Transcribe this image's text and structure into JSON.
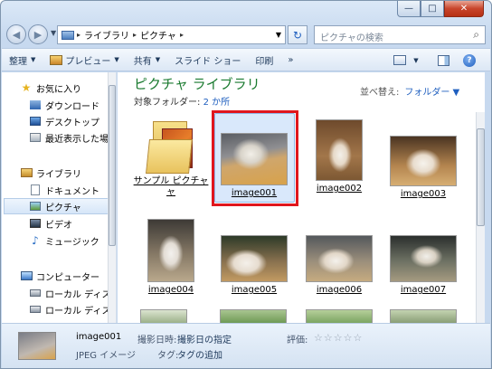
{
  "window": {
    "minimize": "—",
    "maximize": "□",
    "close": "✕"
  },
  "nav": {
    "back_icon": "back-arrow-icon",
    "forward_icon": "forward-arrow-icon"
  },
  "address": {
    "crumbs": [
      "ライブラリ",
      "ピクチャ"
    ],
    "sep": "▸"
  },
  "search": {
    "placeholder": "ピクチャの検索"
  },
  "toolbar": {
    "organize": "整理",
    "preview": "プレビュー",
    "share": "共有",
    "slideshow": "スライド ショー",
    "print": "印刷",
    "more": "»",
    "drop": "▼"
  },
  "sidebar": {
    "favorites": "お気に入り",
    "downloads": "ダウンロード",
    "desktop": "デスクトップ",
    "recent": "最近表示した場所",
    "libraries": "ライブラリ",
    "documents": "ドキュメント",
    "pictures": "ピクチャ",
    "videos": "ビデオ",
    "music": "ミュージック",
    "computer": "コンピューター",
    "local1": "ローカル ディスク",
    "local2": "ローカル ディスク"
  },
  "content": {
    "title": "ピクチャ ライブラリ",
    "subtitle": "対象フォルダー:",
    "count": "2 か所",
    "arrange_label": "並べ替え:",
    "arrange_value": "フォルダー ▼"
  },
  "items": [
    {
      "label": "サンプル ピクチャ",
      "label2": "ャ"
    },
    {
      "label": "image001"
    },
    {
      "label": "image002"
    },
    {
      "label": "image003"
    },
    {
      "label": "image004"
    },
    {
      "label": "image005"
    },
    {
      "label": "image006"
    },
    {
      "label": "image007"
    }
  ],
  "details": {
    "name": "image001",
    "type": "JPEG イメージ",
    "date_label": "撮影日時:",
    "date_value": "撮影日の指定",
    "tag_label": "タグ:",
    "tag_value": "タグの追加",
    "rating_label": "評価:",
    "stars": "☆☆☆☆☆"
  }
}
